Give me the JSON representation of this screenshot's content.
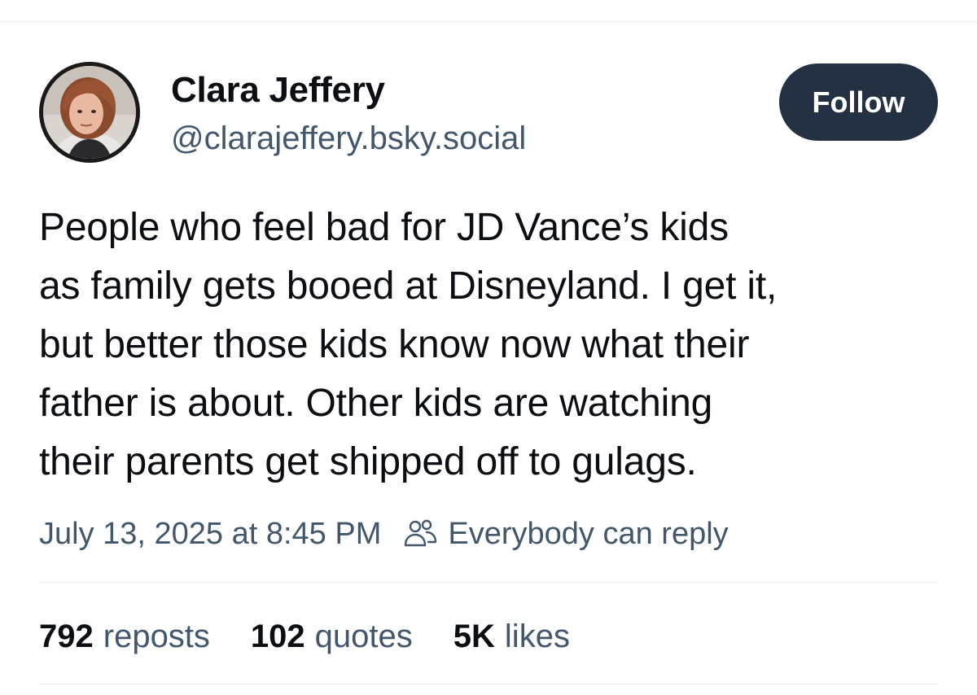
{
  "author": {
    "display_name": "Clara Jeffery",
    "handle": "@clarajeffery.bsky.social"
  },
  "follow_button": {
    "label": "Follow",
    "background": "#233142"
  },
  "post": {
    "text_lines": [
      "People who feel bad for JD Vance’s kids",
      "as family gets booed at Disneyland. I get it,",
      "but better those kids know now what their",
      "father is about. Other kids are watching",
      "their parents get shipped off to gulags."
    ]
  },
  "meta": {
    "timestamp": "July 13, 2025 at 8:45 PM",
    "reply_icon": "people-icon",
    "reply_setting": "Everybody can reply"
  },
  "stats": {
    "reposts": {
      "count": "792",
      "label": "reposts"
    },
    "quotes": {
      "count": "102",
      "label": "quotes"
    },
    "likes": {
      "count": "5K",
      "label": "likes"
    }
  },
  "colors": {
    "text_primary": "#0b0f14",
    "text_secondary": "#42576c",
    "divider": "#e6e8eb"
  }
}
